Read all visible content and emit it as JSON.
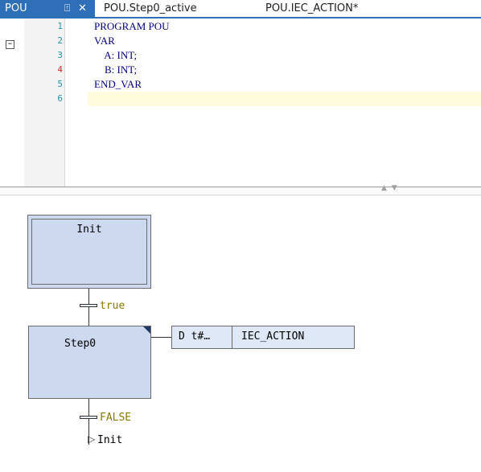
{
  "tabs": {
    "active": {
      "label": "POU",
      "pin_glyph": "⍐",
      "close_glyph": "✕"
    },
    "others": [
      {
        "label": "POU.Step0_active"
      },
      {
        "label": "POU.IEC_ACTION*"
      }
    ]
  },
  "editor": {
    "fold_glyph": "−",
    "lines": [
      {
        "num": "1",
        "text": "PROGRAM POU"
      },
      {
        "num": "2",
        "text": "VAR"
      },
      {
        "num": "3",
        "text": "    A: INT;"
      },
      {
        "num": "4",
        "text": "    B: INT;"
      },
      {
        "num": "5",
        "text": "END_VAR"
      },
      {
        "num": "6",
        "text": ""
      }
    ]
  },
  "splitter": {
    "arrows": "▲▼"
  },
  "sfc": {
    "init_step": "Init",
    "transition1": "true",
    "step0": "Step0",
    "action": {
      "qualifier": "D  t#…",
      "name": "IEC_ACTION"
    },
    "transition2": "FALSE",
    "jump_arrow": "▷",
    "jump_target": "Init"
  },
  "colors": {
    "tab_accent": "#2e6fb7",
    "step_fill": "#cdd9ee",
    "condition_text": "#8a7a00",
    "keyword": "#000080",
    "highlight_line": "#fffbdc"
  }
}
